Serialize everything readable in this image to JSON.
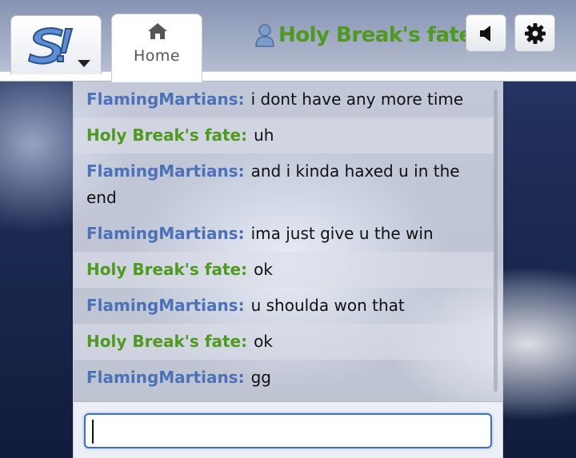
{
  "header": {
    "home_tab": {
      "label": "Home",
      "icon": "home-icon"
    },
    "logo": {
      "icon": "showdown-logo-icon",
      "menu_icon": "caret-down-icon"
    },
    "user": {
      "name": "Holy Break's fate",
      "icon": "user-icon",
      "color": "#4e9a1f"
    },
    "sound_button": {
      "icon": "volume-icon"
    },
    "settings_button": {
      "icon": "gear-icon"
    }
  },
  "chat": {
    "messages": [
      {
        "sender": "FlamingMartians:",
        "text": "i dont have any more time",
        "color": "#4b72b8"
      },
      {
        "sender": "Holy Break's fate:",
        "text": "uh",
        "color": "#4e9a1f"
      },
      {
        "sender": "FlamingMartians:",
        "text": "and i kinda haxed u in the end",
        "color": "#4b72b8"
      },
      {
        "sender": "FlamingMartians:",
        "text": "ima just give u the win",
        "color": "#4b72b8"
      },
      {
        "sender": "Holy Break's fate:",
        "text": "ok",
        "color": "#4e9a1f"
      },
      {
        "sender": "FlamingMartians:",
        "text": "u shoulda won that",
        "color": "#4b72b8"
      },
      {
        "sender": "Holy Break's fate:",
        "text": "ok",
        "color": "#4e9a1f"
      },
      {
        "sender": "FlamingMartians:",
        "text": "gg",
        "color": "#4b72b8"
      }
    ],
    "input": {
      "value": "",
      "placeholder": ""
    }
  }
}
